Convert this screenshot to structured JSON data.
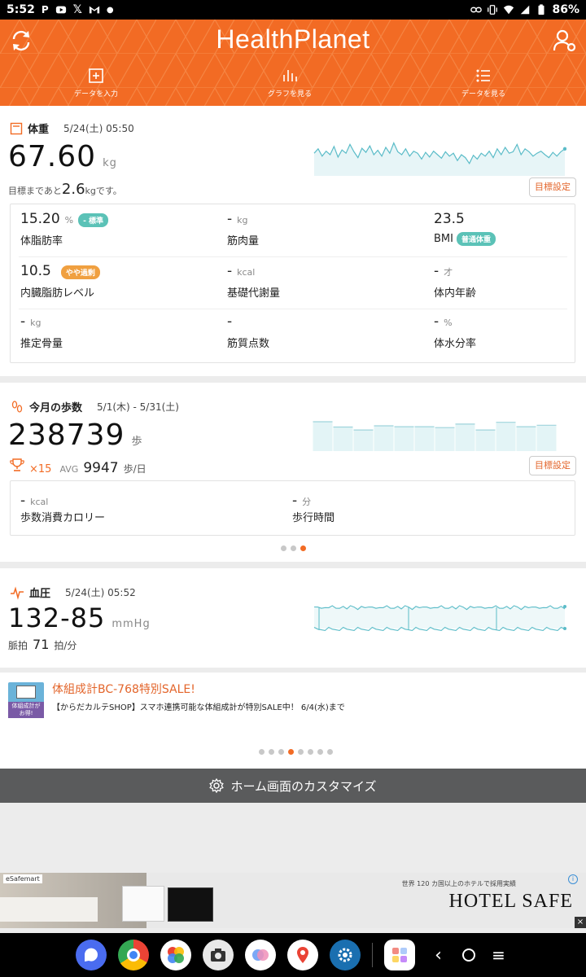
{
  "status_bar": {
    "time": "5:52",
    "battery": "86%"
  },
  "header": {
    "title": "HealthPlanet",
    "nav": [
      {
        "label": "データを入力",
        "icon": "plus-square-icon"
      },
      {
        "label": "グラフを見る",
        "icon": "bar-chart-icon"
      },
      {
        "label": "データを見る",
        "icon": "list-icon"
      }
    ]
  },
  "weight": {
    "title": "体重",
    "date": "5/24(土) 05:50",
    "value": "67.60",
    "unit": "kg",
    "goal_prefix": "目標まであと",
    "goal_value": "2.6",
    "goal_unit": "kg",
    "goal_suffix": "です。",
    "goal_button": "目標設定",
    "sparkline": [
      0.55,
      0.7,
      0.45,
      0.62,
      0.5,
      0.78,
      0.42,
      0.66,
      0.55,
      0.85,
      0.6,
      0.4,
      0.72,
      0.58,
      0.8,
      0.5,
      0.65,
      0.45,
      0.75,
      0.55,
      0.9,
      0.6,
      0.5,
      0.7,
      0.45,
      0.62,
      0.55,
      0.35,
      0.58,
      0.42,
      0.62,
      0.5,
      0.38,
      0.6,
      0.45,
      0.55,
      0.3,
      0.5,
      0.4,
      0.2,
      0.48,
      0.35,
      0.55,
      0.45,
      0.62,
      0.4,
      0.7,
      0.5,
      0.75,
      0.55,
      0.6,
      0.85,
      0.5,
      0.7,
      0.6,
      0.45,
      0.55,
      0.62,
      0.5,
      0.4,
      0.58,
      0.45,
      0.6,
      0.7
    ],
    "metrics": [
      {
        "value": "15.20",
        "unit": "%",
        "label": "体脂肪率",
        "badge": "- 標準",
        "badge_color": "#5bc2b7"
      },
      {
        "value": "-",
        "unit": "kg",
        "label": "筋肉量",
        "badge": "",
        "badge_color": ""
      },
      {
        "value": "23.5",
        "unit": "",
        "label": "BMI",
        "badge": "普通体重",
        "badge_color": "#5bc2b7"
      },
      {
        "value": "10.5",
        "unit": "",
        "label": "内臓脂肪レベル",
        "badge": "やや過剰",
        "badge_color": "#f0a040"
      },
      {
        "value": "-",
        "unit": "kcal",
        "label": "基礎代謝量",
        "badge": "",
        "badge_color": ""
      },
      {
        "value": "-",
        "unit": "才",
        "label": "体内年齢",
        "badge": "",
        "badge_color": ""
      },
      {
        "value": "-",
        "unit": "kg",
        "label": "推定骨量",
        "badge": "",
        "badge_color": ""
      },
      {
        "value": "-",
        "unit": "",
        "label": "筋質点数",
        "badge": "",
        "badge_color": ""
      },
      {
        "value": "-",
        "unit": "%",
        "label": "体水分率",
        "badge": "",
        "badge_color": ""
      }
    ]
  },
  "steps": {
    "title": "今月の歩数",
    "date": "5/1(木) - 5/31(土)",
    "value": "238739",
    "unit": "歩",
    "trophy_count": "×15",
    "avg_label": "AVG",
    "avg_value": "9947",
    "avg_unit": "歩/日",
    "goal_button": "目標設定",
    "bars": [
      1.0,
      0.82,
      0.72,
      0.86,
      0.83,
      0.83,
      0.8,
      0.92,
      0.72,
      0.98,
      0.83,
      0.88
    ],
    "metrics": [
      {
        "value": "-",
        "unit": "kcal",
        "label": "歩数消費カロリー"
      },
      {
        "value": "-",
        "unit": "分",
        "label": "歩行時間"
      }
    ],
    "page_count": 3,
    "page_active": 3
  },
  "blood_pressure": {
    "title": "血圧",
    "date": "5/24(土) 05:52",
    "value": "132-85",
    "unit": "mmHg",
    "pulse_label": "脈拍",
    "pulse_value": "71",
    "pulse_unit": "拍/分"
  },
  "promo": {
    "title": "体組成計BC-768特別SALE!",
    "text": "【からだカルテSHOP】スマホ連携可能な体組成計が特別SALE中！ 6/4(水)まで",
    "thumb_caption": "体組成計が お得!",
    "page_count": 8,
    "page_active": 4
  },
  "customize": {
    "label": "ホーム画面のカスタマイズ"
  },
  "ad": {
    "brand": "eSafemart",
    "headline": "HOTEL SAFE",
    "subline": "世界 120 カ国以上のホテルで採用実績"
  },
  "colors": {
    "accent": "#f26b24",
    "teal": "#5bbcc8",
    "badge_teal": "#5bc2b7",
    "badge_orange": "#f0a040"
  }
}
